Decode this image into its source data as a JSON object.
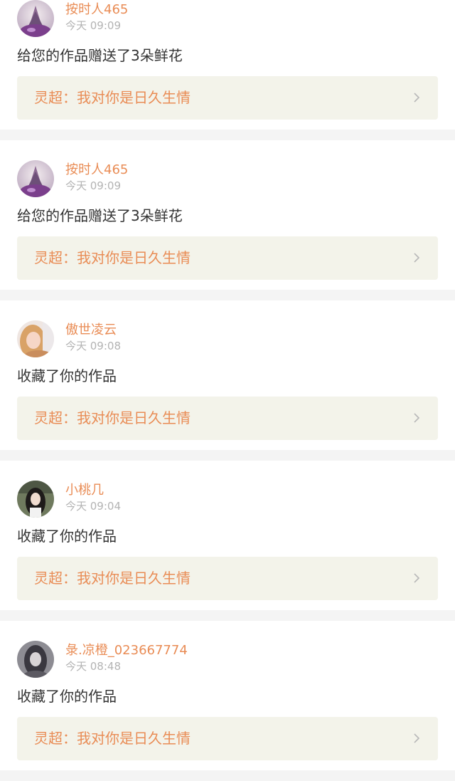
{
  "notifications": [
    {
      "user": "按时人465",
      "time": "今天 09:09",
      "action": "给您的作品赠送了3朵鲜花",
      "work_title": "灵超：我对你是日久生情",
      "avatar_icon": "avatar-purple-castle"
    },
    {
      "user": "按时人465",
      "time": "今天 09:09",
      "action": "给您的作品赠送了3朵鲜花",
      "work_title": "灵超：我对你是日久生情",
      "avatar_icon": "avatar-purple-castle"
    },
    {
      "user": "傲世凌云",
      "time": "今天 09:08",
      "action": "收藏了你的作品",
      "work_title": "灵超：我对你是日久生情",
      "avatar_icon": "avatar-blonde-girl"
    },
    {
      "user": "小桃几",
      "time": "今天 09:04",
      "action": "收藏了你的作品",
      "work_title": "灵超：我对你是日久生情",
      "avatar_icon": "avatar-dark-hair-girl"
    },
    {
      "user": "彔.凉橙_023667774",
      "time": "今天 08:48",
      "action": "收藏了你的作品",
      "work_title": "灵超：我对你是日久生情",
      "avatar_icon": "avatar-grey-portrait"
    }
  ],
  "colors": {
    "accent": "#e98c55",
    "time_text": "#b3b3b3",
    "body_text": "#333333",
    "work_box_bg": "#f3f3ea",
    "separator": "#f4f4f4"
  }
}
